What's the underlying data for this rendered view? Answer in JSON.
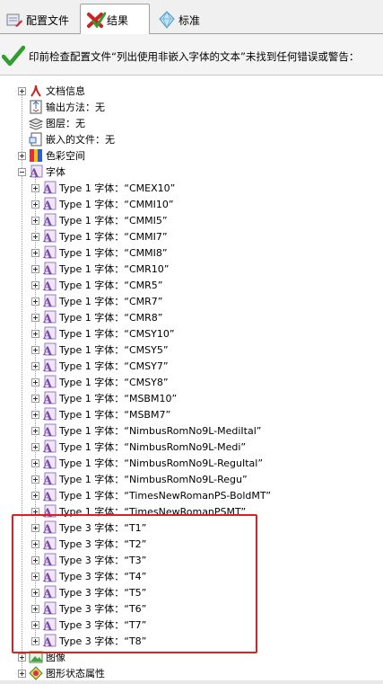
{
  "tabs": [
    {
      "label": "配置文件",
      "icon": "wrench-icon"
    },
    {
      "label": "结果",
      "icon": "red-x-check-icon",
      "active": true
    },
    {
      "label": "标准",
      "icon": "diamond-icon"
    }
  ],
  "banner": {
    "message": "印前检查配置文件“列出使用非嵌入字体的文本”未找到任何错误或警告：",
    "icon": "green-check-icon"
  },
  "tree": [
    {
      "label": "文档信息",
      "level": 1,
      "expander": "plus",
      "icon": "pdf-icon"
    },
    {
      "label": "输出方法：无",
      "level": 1,
      "expander": "none",
      "icon": "output-icon"
    },
    {
      "label": "图层：无",
      "level": 1,
      "expander": "none",
      "icon": "layers-icon"
    },
    {
      "label": "嵌入的文件：无",
      "level": 1,
      "expander": "none",
      "icon": "embedded-file-icon"
    },
    {
      "label": "色彩空间",
      "level": 1,
      "expander": "plus",
      "icon": "color-space-icon"
    },
    {
      "label": "字体",
      "level": 1,
      "expander": "minus",
      "icon": "font-icon"
    },
    {
      "label": "Type 1 字体：“CMEX10”",
      "level": 2,
      "expander": "plus",
      "icon": "font-icon"
    },
    {
      "label": "Type 1 字体：“CMMI10”",
      "level": 2,
      "expander": "plus",
      "icon": "font-icon"
    },
    {
      "label": "Type 1 字体：“CMMI5”",
      "level": 2,
      "expander": "plus",
      "icon": "font-icon"
    },
    {
      "label": "Type 1 字体：“CMMI7”",
      "level": 2,
      "expander": "plus",
      "icon": "font-icon"
    },
    {
      "label": "Type 1 字体：“CMMI8”",
      "level": 2,
      "expander": "plus",
      "icon": "font-icon"
    },
    {
      "label": "Type 1 字体：“CMR10”",
      "level": 2,
      "expander": "plus",
      "icon": "font-icon"
    },
    {
      "label": "Type 1 字体：“CMR5”",
      "level": 2,
      "expander": "plus",
      "icon": "font-icon"
    },
    {
      "label": "Type 1 字体：“CMR7”",
      "level": 2,
      "expander": "plus",
      "icon": "font-icon"
    },
    {
      "label": "Type 1 字体：“CMR8”",
      "level": 2,
      "expander": "plus",
      "icon": "font-icon"
    },
    {
      "label": "Type 1 字体：“CMSY10”",
      "level": 2,
      "expander": "plus",
      "icon": "font-icon"
    },
    {
      "label": "Type 1 字体：“CMSY5”",
      "level": 2,
      "expander": "plus",
      "icon": "font-icon"
    },
    {
      "label": "Type 1 字体：“CMSY7”",
      "level": 2,
      "expander": "plus",
      "icon": "font-icon"
    },
    {
      "label": "Type 1 字体：“CMSY8”",
      "level": 2,
      "expander": "plus",
      "icon": "font-icon"
    },
    {
      "label": "Type 1 字体：“MSBM10”",
      "level": 2,
      "expander": "plus",
      "icon": "font-icon"
    },
    {
      "label": "Type 1 字体：“MSBM7”",
      "level": 2,
      "expander": "plus",
      "icon": "font-icon"
    },
    {
      "label": "Type 1 字体：“NimbusRomNo9L-MediItal”",
      "level": 2,
      "expander": "plus",
      "icon": "font-icon"
    },
    {
      "label": "Type 1 字体：“NimbusRomNo9L-Medi”",
      "level": 2,
      "expander": "plus",
      "icon": "font-icon"
    },
    {
      "label": "Type 1 字体：“NimbusRomNo9L-ReguItal”",
      "level": 2,
      "expander": "plus",
      "icon": "font-icon"
    },
    {
      "label": "Type 1 字体：“NimbusRomNo9L-Regu”",
      "level": 2,
      "expander": "plus",
      "icon": "font-icon"
    },
    {
      "label": "Type 1 字体：“TimesNewRomanPS-BoldMT”",
      "level": 2,
      "expander": "plus",
      "icon": "font-icon"
    },
    {
      "label": "Type 1 字体：“TimesNewRomanPSMT”",
      "level": 2,
      "expander": "plus",
      "icon": "font-icon"
    },
    {
      "label": "Type 3 字体：“T1”",
      "level": 2,
      "expander": "plus",
      "icon": "font-icon"
    },
    {
      "label": "Type 3 字体：“T2”",
      "level": 2,
      "expander": "plus",
      "icon": "font-icon"
    },
    {
      "label": "Type 3 字体：“T3”",
      "level": 2,
      "expander": "plus",
      "icon": "font-icon"
    },
    {
      "label": "Type 3 字体：“T4”",
      "level": 2,
      "expander": "plus",
      "icon": "font-icon"
    },
    {
      "label": "Type 3 字体：“T5”",
      "level": 2,
      "expander": "plus",
      "icon": "font-icon"
    },
    {
      "label": "Type 3 字体：“T6”",
      "level": 2,
      "expander": "plus",
      "icon": "font-icon"
    },
    {
      "label": "Type 3 字体：“T7”",
      "level": 2,
      "expander": "plus",
      "icon": "font-icon"
    },
    {
      "label": "Type 3 字体：“T8”",
      "level": 2,
      "expander": "plus",
      "icon": "font-icon"
    },
    {
      "label": "图像",
      "level": 1,
      "expander": "plus",
      "icon": "image-icon"
    },
    {
      "label": "图形状态属性",
      "level": 1,
      "expander": "plus",
      "icon": "graphics-state-icon"
    }
  ],
  "colors": {
    "highlight": "#e02020",
    "check": "#2e9e2e",
    "font_icon": "#7a4aa8"
  }
}
